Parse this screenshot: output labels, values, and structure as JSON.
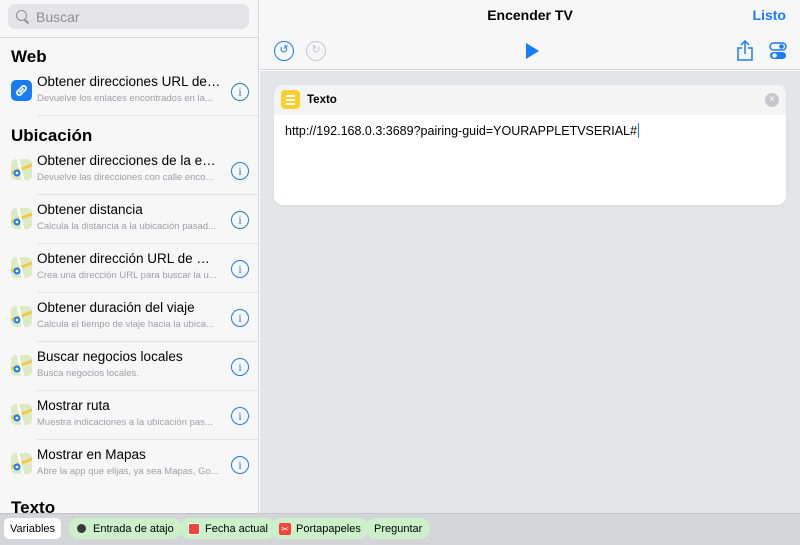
{
  "search": {
    "placeholder": "Buscar"
  },
  "sidebar": {
    "sections": [
      {
        "heading": "Web",
        "items": [
          {
            "title": "Obtener direcciones URL de l...",
            "subtitle": "Devuelve los enlaces encontrados en la...",
            "icon": "link-icon"
          }
        ]
      },
      {
        "heading": "Ubicación",
        "items": [
          {
            "title": "Obtener direcciones de la entr...",
            "subtitle": "Devuelve las direcciones con calle enco...",
            "icon": "maps-icon"
          },
          {
            "title": "Obtener distancia",
            "subtitle": "Calcula la distancia a la ubicación pasad...",
            "icon": "maps-icon"
          },
          {
            "title": "Obtener dirección URL de Ma...",
            "subtitle": "Crea una dirección URL para buscar la u...",
            "icon": "maps-icon"
          },
          {
            "title": "Obtener duración del viaje",
            "subtitle": "Calcula el tiempo de viaje hacia la ubica...",
            "icon": "maps-icon"
          },
          {
            "title": "Buscar negocios locales",
            "subtitle": "Busca negocios locales.",
            "icon": "maps-icon"
          },
          {
            "title": "Mostrar ruta",
            "subtitle": "Muestra indicaciones a la ubicación pas...",
            "icon": "maps-icon"
          },
          {
            "title": "Mostrar en Mapas",
            "subtitle": "Abre la app que elijas, ya sea Mapas, Go...",
            "icon": "maps-icon"
          }
        ]
      },
      {
        "heading": "Texto",
        "items": []
      }
    ],
    "info_glyph": "i"
  },
  "header": {
    "title": "Encender TV",
    "done_label": "Listo"
  },
  "toolbar": {
    "undo_icon": "undo-icon",
    "redo_icon": "redo-icon",
    "play_icon": "play-icon",
    "share_icon": "share-icon",
    "settings_icon": "settings-toggle-icon"
  },
  "action_card": {
    "title": "Texto",
    "close_glyph": "×",
    "text": "http://192.168.0.3:3689?pairing-guid=YOURAPPLETVSERIAL#"
  },
  "bottom_bar": {
    "variables_label": "Variables",
    "chips": [
      "Entrada de atajo",
      "Fecha actual",
      "Portapapeles",
      "Preguntar"
    ]
  },
  "colors": {
    "accent": "#1a7cf5",
    "text_action": "#fcd02c",
    "variable_chip": "#ccf0c9"
  }
}
